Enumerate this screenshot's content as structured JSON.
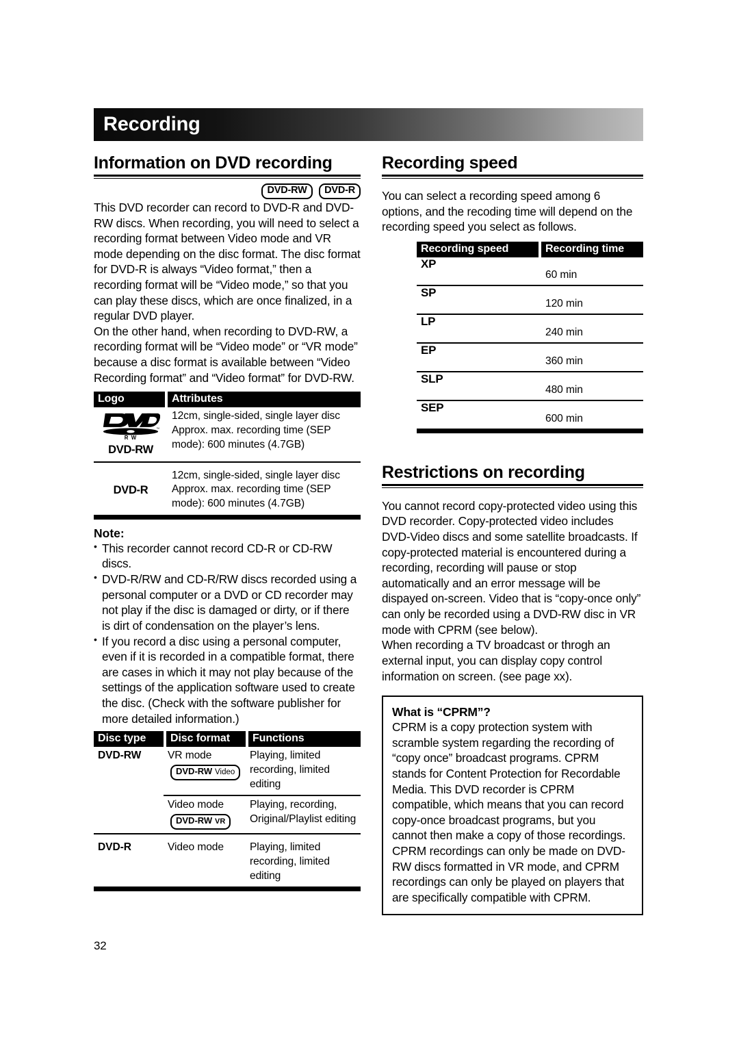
{
  "page": {
    "chapter_banner": "Recording",
    "page_number": "32"
  },
  "left_column": {
    "heading": "Information on DVD recording",
    "media_badges": [
      {
        "main": "DVD-RW",
        "sub": ""
      },
      {
        "main": "DVD-R",
        "sub": ""
      }
    ],
    "paragraphs": [
      "This DVD recorder can record to DVD-R and DVD-RW discs. When recording, you will need to select a recording format between Video mode and VR mode depending on the disc format. The disc format for DVD-R is always “Video format,” then a recording format will be “Video mode,” so that you can play these discs, which are once finalized, in a regular DVD player.",
      "On the other hand, when recording to DVD-RW, a recording format will be “Video mode” or “VR mode” because a disc format is available between “Video Recording format” and “Video format” for DVD-RW."
    ],
    "logo_table": {
      "headers": [
        "Logo",
        "Attributes"
      ],
      "rows": [
        {
          "logo_name": "DVD-RW",
          "logo_mark": "dvd-rw-disc-logo",
          "attributes": "12cm, single-sided, single layer disc Approx. max. recording time (SEP mode): 600 minutes (4.7GB)"
        },
        {
          "logo_name": "DVD-R",
          "logo_mark": "",
          "attributes": "12cm, single-sided, single layer disc Approx. max. recording time (SEP mode): 600 minutes (4.7GB)"
        }
      ]
    },
    "note": {
      "title": "Note:",
      "items": [
        "This recorder cannot record CD-R or CD-RW discs.",
        "DVD-R/RW and CD-R/RW discs recorded using a personal computer or a DVD or CD recorder may not play if the disc is damaged or dirty, or if there is dirt of condensation on the player’s lens.",
        "If you record a disc using a personal computer, even if it is recorded in a compatible format, there are cases in which it may not play because of the settings of the application software used to create the disc. (Check with the software publisher for more detailed information.)"
      ]
    },
    "disc_table": {
      "headers": [
        "Disc type",
        "Disc format",
        "Functions"
      ],
      "rows": [
        {
          "disc_type": "DVD-RW",
          "disc_format": "VR mode",
          "format_badge_main": "DVD-RW",
          "format_badge_sub": "Video",
          "functions": "Playing, limited recording, limited editing"
        },
        {
          "disc_type": "",
          "disc_format": "Video mode",
          "format_badge_main": "DVD-RW",
          "format_badge_sub": "VR",
          "functions": "Playing, recording, Original/Playlist editing"
        },
        {
          "disc_type": "DVD-R",
          "disc_format": "Video mode",
          "format_badge_main": "",
          "format_badge_sub": "",
          "functions": "Playing, limited recording, limited editing"
        }
      ]
    }
  },
  "right_column": {
    "speed_section": {
      "heading": "Recording speed",
      "paragraph": "You can select a recording speed among 6 options, and the recoding time will depend on the recording speed you select as follows.",
      "table": {
        "headers": [
          "Recording speed",
          "Recording time"
        ],
        "rows": [
          {
            "speed": "XP",
            "time": "60 min"
          },
          {
            "speed": "SP",
            "time": "120 min"
          },
          {
            "speed": "LP",
            "time": "240 min"
          },
          {
            "speed": "EP",
            "time": "360 min"
          },
          {
            "speed": "SLP",
            "time": "480 min"
          },
          {
            "speed": "SEP",
            "time": "600 min"
          }
        ]
      }
    },
    "restrictions_section": {
      "heading": "Restrictions on recording",
      "paragraphs": [
        "You cannot record copy-protected video using this DVD recorder. Copy-protected video includes DVD-Video discs and some satellite broadcasts. If copy-protected material is encountered during a recording, recording will pause or stop automatically and an error message will be dispayed on-screen. Video that is “copy-once only” can only be recorded using a DVD-RW disc in VR mode with CPRM (see below).",
        "When recording a TV broadcast or throgh an external input, you can display copy control information on screen. (see page xx)."
      ],
      "cprm_box": {
        "title": "What is “CPRM”?",
        "body": "CPRM is a copy protection system with scramble system regarding the recording of “copy once” broadcast programs. CPRM stands for Content Protection for Recordable Media. This DVD recorder is CPRM compatible, which means that you can  record copy-once broadcast programs, but you cannot then make a copy of those recordings. CPRM recordings can only be made on DVD-RW discs formatted in VR mode, and CPRM recordings can only be played on players that are specifically compatible with CPRM."
      }
    }
  },
  "colors": {
    "ink": "#000000",
    "paper": "#ffffff",
    "banner_dark": "#0a0a0a",
    "banner_light": "#bdbdbd"
  }
}
